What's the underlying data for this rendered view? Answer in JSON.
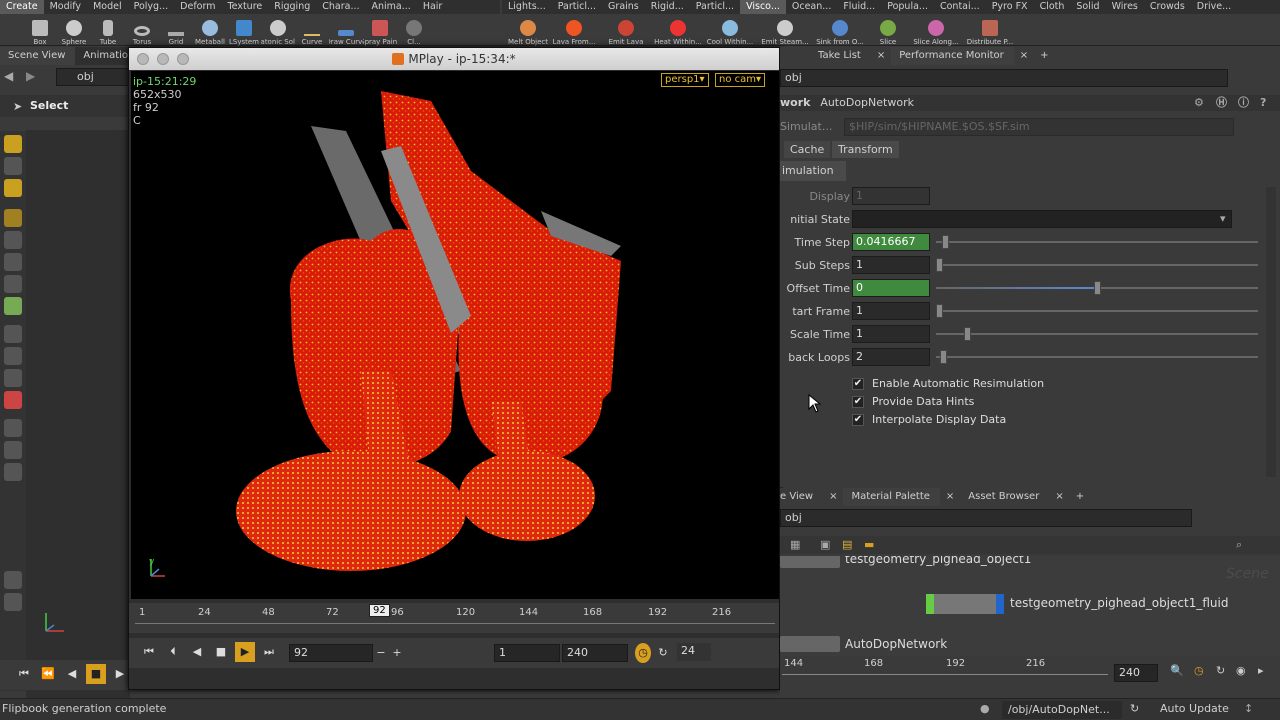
{
  "shelf": {
    "left_tabs": [
      "Create",
      "Modify",
      "Model",
      "Polyg...",
      "Deform",
      "Texture",
      "Rigging",
      "Chara...",
      "Anima...",
      "Hair"
    ],
    "right_tabs": [
      "Lights...",
      "Particl...",
      "Grains",
      "Rigid...",
      "Particl...",
      "Visco...",
      "Ocean...",
      "Fluid...",
      "Popula...",
      "Contai...",
      "Pyro FX",
      "Cloth",
      "Solid",
      "Wires",
      "Crowds",
      "Drive..."
    ],
    "left_tools": [
      "Box",
      "Sphere",
      "Tube",
      "Torus",
      "Grid",
      "Metaball",
      "LSystem",
      "Platonic Sol...",
      "Curve",
      "Draw Curve",
      "Spray Paint",
      "Cl..."
    ],
    "right_tools": [
      "Melt Object",
      "Lava From...",
      "Emit Lava",
      "Heat Within...",
      "Cool Within...",
      "Emit Steam...",
      "Sink from O...",
      "Slice",
      "Slice Along...",
      "Distribute P..."
    ]
  },
  "left": {
    "tabs": [
      "Scene View",
      "Animatio"
    ],
    "path": "obj",
    "select_label": "Select"
  },
  "mplay": {
    "title": "MPlay - ip-15:34:*",
    "overlay_time": "ip-15:21:29",
    "overlay_res": "652x530",
    "overlay_frame": "fr 92",
    "overlay_c": "C",
    "persp_label": "persp1▾",
    "cam_label": "no cam▾",
    "axis_y": "y",
    "axis_x": "x",
    "timeline_ticks": [
      "1",
      "24",
      "48",
      "72",
      "96",
      "120",
      "144",
      "168",
      "192",
      "216"
    ],
    "current_frame_marker": "92",
    "frame_field": "92",
    "start_field": "1",
    "end_field": "240",
    "fps_field": "24"
  },
  "right_top": {
    "tabs": [
      "Take List",
      "Performance Monitor"
    ],
    "path": "obj",
    "network_label": "work",
    "network_name": "AutoDopNetwork",
    "simulation_label": "Simulat...",
    "simulation_path": "$HIP/sim/$HIPNAME.$OS.$SF.sim",
    "subtabs": [
      "Cache",
      "Transform"
    ],
    "section": "imulation",
    "display_label": "Display",
    "display_value": "1",
    "initial_state_label": "nitial State",
    "params": [
      {
        "label": "Time Step",
        "value": "0.0416667",
        "green": true,
        "knob": 0.02
      },
      {
        "label": "Sub Steps",
        "value": "1",
        "green": false,
        "knob": 0.0
      },
      {
        "label": "Offset Time",
        "value": "0",
        "green": true,
        "knob": 0.5
      },
      {
        "label": "tart Frame",
        "value": "1",
        "green": false,
        "knob": 0.0
      },
      {
        "label": "Scale Time",
        "value": "1",
        "green": false,
        "knob": 0.1
      },
      {
        "label": "back Loops",
        "value": "2",
        "green": false,
        "knob": 0.01
      }
    ],
    "checkboxes": [
      "Enable Automatic Resimulation",
      "Provide Data Hints",
      "Interpolate Display Data"
    ]
  },
  "right_bottom": {
    "tabs": [
      "e View",
      "Material Palette",
      "Asset Browser"
    ],
    "path": "obj",
    "scene_watermark": "Scene",
    "node1": "testgeometry_pighead_object1",
    "node2": "testgeometry_pighead_object1_fluid",
    "node3": "AutoDopNetwork",
    "ticks": [
      "144",
      "168",
      "192",
      "216"
    ],
    "end_frame": "240"
  },
  "status": {
    "message": "Flipbook generation complete",
    "path": "/obj/AutoDopNet...",
    "update_mode": "Auto Update"
  },
  "colors": {
    "accent": "#f0c020",
    "green": "#3f8a3f",
    "particles": "#e02010"
  }
}
